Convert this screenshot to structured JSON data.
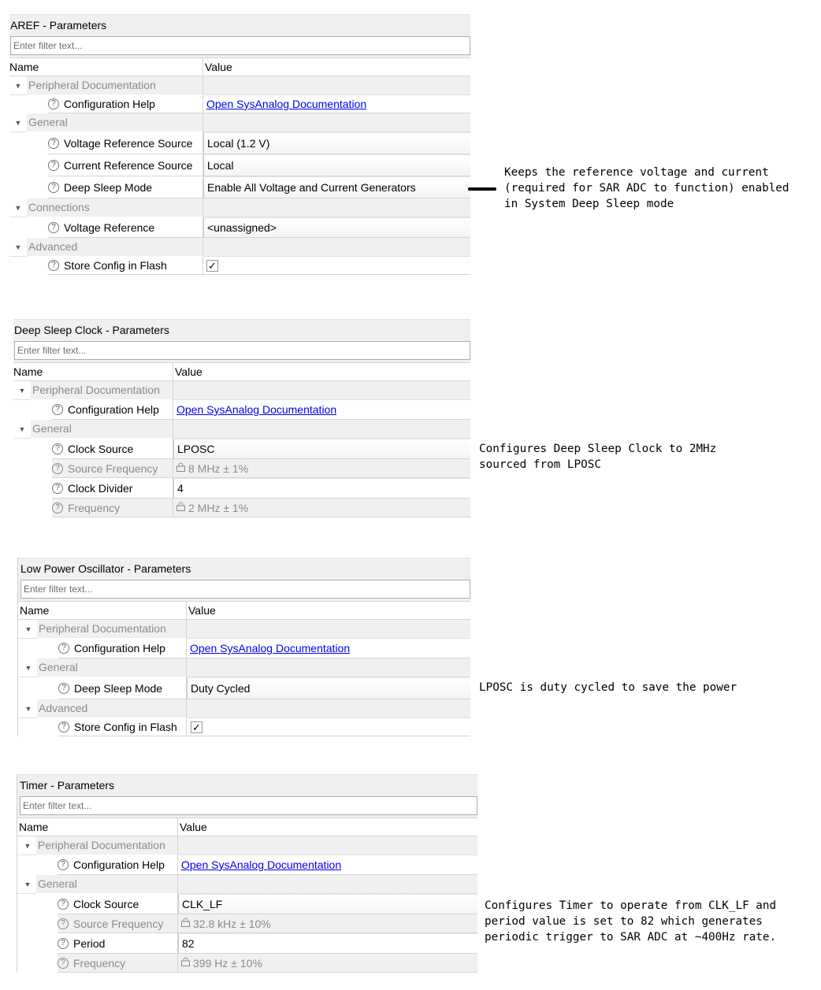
{
  "common": {
    "filter_placeholder": "Enter filter text...",
    "col_name": "Name",
    "col_value": "Value",
    "doc_link": "Open SysAnalog Documentation"
  },
  "aref": {
    "title": "AREF - Parameters",
    "groups": {
      "peripheral_doc": "Peripheral Documentation",
      "general": "General",
      "connections": "Connections",
      "advanced": "Advanced"
    },
    "params": {
      "config_help": "Configuration Help",
      "voltage_ref_source": {
        "label": "Voltage Reference Source",
        "value": "Local (1.2 V)"
      },
      "current_ref_source": {
        "label": "Current Reference Source",
        "value": "Local"
      },
      "deep_sleep_mode": {
        "label": "Deep Sleep Mode",
        "value": "Enable All Voltage and Current Generators"
      },
      "voltage_reference": {
        "label": "Voltage Reference",
        "value": "<unassigned>"
      },
      "store_config": {
        "label": "Store Config in Flash",
        "checked": true,
        "mark": "✓"
      }
    },
    "note": "Keeps the reference voltage and current\n(required for SAR ADC to function) enabled\nin System Deep Sleep mode"
  },
  "deep_sleep_clock": {
    "title": "Deep Sleep Clock - Parameters",
    "groups": {
      "peripheral_doc": "Peripheral Documentation",
      "general": "General"
    },
    "params": {
      "config_help": "Configuration Help",
      "clock_source": {
        "label": "Clock Source",
        "value": "LPOSC"
      },
      "source_frequency": {
        "label": "Source Frequency",
        "value": "8 MHz ± 1%"
      },
      "clock_divider": {
        "label": "Clock Divider",
        "value": "4"
      },
      "frequency": {
        "label": "Frequency",
        "value": "2 MHz ± 1%"
      }
    },
    "note": "Configures Deep Sleep Clock to 2MHz\nsourced from LPOSC"
  },
  "lposc": {
    "title": "Low Power Oscillator - Parameters",
    "groups": {
      "peripheral_doc": "Peripheral Documentation",
      "general": "General",
      "advanced": "Advanced"
    },
    "params": {
      "config_help": "Configuration Help",
      "deep_sleep_mode": {
        "label": "Deep Sleep Mode",
        "value": "Duty Cycled"
      },
      "store_config": {
        "label": "Store Config in Flash",
        "checked": true,
        "mark": "✓"
      }
    },
    "note": "LPOSC is duty cycled to save the power"
  },
  "timer": {
    "title": "Timer - Parameters",
    "groups": {
      "peripheral_doc": "Peripheral Documentation",
      "general": "General"
    },
    "params": {
      "config_help": "Configuration Help",
      "clock_source": {
        "label": "Clock Source",
        "value": "CLK_LF"
      },
      "source_frequency": {
        "label": "Source Frequency",
        "value": "32.8 kHz ± 10%"
      },
      "period": {
        "label": "Period",
        "value": "82"
      },
      "frequency": {
        "label": "Frequency",
        "value": "399 Hz ± 10%"
      }
    },
    "note": "Configures Timer to operate from CLK_LF and\nperiod value is set to 82 which generates\nperiodic trigger to SAR ADC at ~400Hz rate."
  },
  "icons": {
    "expand": "▼",
    "help": "?",
    "lock": "🔒"
  }
}
